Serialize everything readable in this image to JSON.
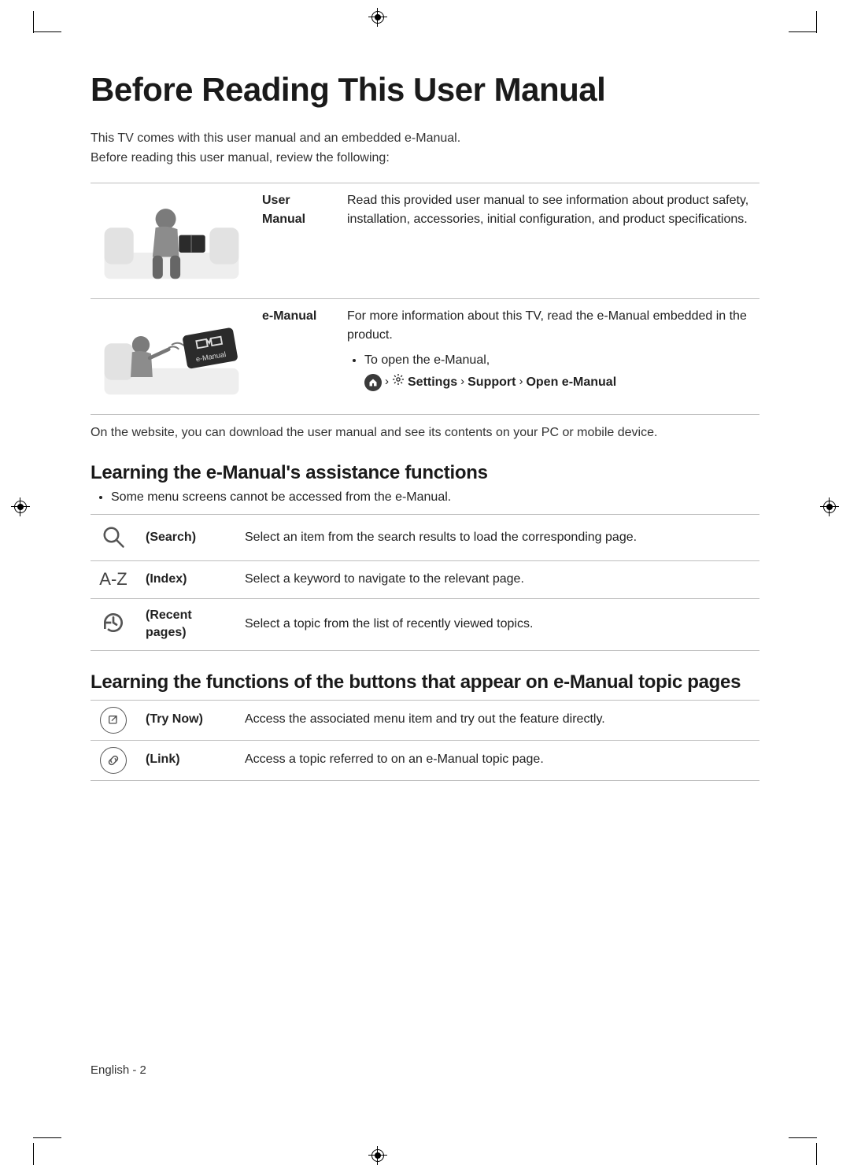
{
  "title": "Before Reading This User Manual",
  "intro_line1": "This TV comes with this user manual and an embedded e-Manual.",
  "intro_line2": "Before reading this user manual, review the following:",
  "manual_rows": [
    {
      "label_line1": "User",
      "label_line2": "Manual",
      "desc": "Read this provided user manual to see information about product safety, installation, accessories, initial configuration, and product specifications."
    },
    {
      "label_line1": "e-Manual",
      "label_line2": "",
      "desc_intro": "For more information about this TV, read the e-Manual embedded in the product.",
      "bullet": "To open the e-Manual,",
      "path": {
        "settings": "Settings",
        "support": "Support",
        "open": "Open e-Manual"
      }
    }
  ],
  "after_table": "On the website, you can download the user manual and see its contents on your PC or mobile device.",
  "section_assist": {
    "heading": "Learning the e-Manual's assistance functions",
    "note": "Some menu screens cannot be accessed from the e-Manual.",
    "rows": [
      {
        "label": "(Search)",
        "desc": "Select an item from the search results to load the corresponding page."
      },
      {
        "label": "(Index)",
        "desc": "Select a keyword to navigate to the relevant page."
      },
      {
        "label": "(Recent pages)",
        "desc": "Select a topic from the list of recently viewed topics."
      }
    ]
  },
  "section_buttons": {
    "heading": "Learning the functions of the buttons that appear on e-Manual topic pages",
    "rows": [
      {
        "label": "(Try Now)",
        "desc": "Access the associated menu item and try out the feature directly."
      },
      {
        "label": "(Link)",
        "desc": "Access a topic referred to on an e-Manual topic page."
      }
    ]
  },
  "footer": {
    "lang": "English",
    "sep": " - ",
    "page": "2"
  },
  "icons": {
    "search": "search-icon",
    "index": "A-Z",
    "recent": "recent-icon",
    "trynow": "try-now-icon",
    "link": "link-icon",
    "home": "home-icon",
    "gear": "gear-icon"
  }
}
